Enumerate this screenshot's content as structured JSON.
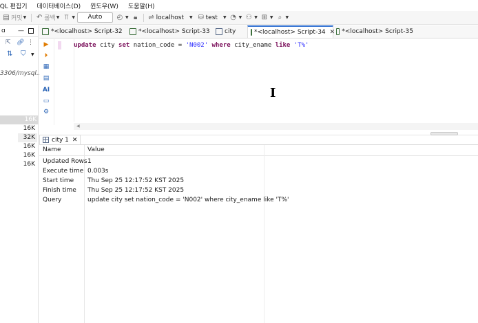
{
  "menu": {
    "items": [
      "SQL 편집기",
      "데이터베이스(D)",
      "윈도우(W)",
      "도움말(H)"
    ]
  },
  "toolbar": {
    "commit_label": "커밋",
    "rollback_label": "롤백",
    "transaction_mode": "Auto",
    "connection": "localhost",
    "database": "test"
  },
  "navigator": {
    "path_text": "3306/mysql...",
    "sizes": [
      "16K",
      "16K",
      "32K",
      "16K",
      "16K",
      "16K"
    ]
  },
  "editor_tabs": [
    {
      "label": "*<localhost> Script-32"
    },
    {
      "label": "*<localhost> Script-33"
    },
    {
      "label": "city"
    },
    {
      "label": "*<localhost> Script-34"
    },
    {
      "label": "*<localhost> Script-35"
    }
  ],
  "editor": {
    "sql": {
      "kw1": "update",
      "t1": "city",
      "kw2": "set",
      "t2": "nation_code =",
      "s1": "'N002'",
      "kw3": "where",
      "t3": "city_ename",
      "kw4": "like",
      "s2": "'T%'"
    },
    "gutter_ai_label": "AI"
  },
  "results": {
    "tab_label": "city 1",
    "header": {
      "name": "Name",
      "value": "Value"
    },
    "rows": [
      {
        "name": "Updated Rows",
        "value": "1"
      },
      {
        "name": "Execute time",
        "value": "0.003s"
      },
      {
        "name": "Start time",
        "value": "Thu Sep 25 12:17:52 KST 2025"
      },
      {
        "name": "Finish time",
        "value": "Thu Sep 25 12:17:52 KST 2025"
      },
      {
        "name": "Query",
        "value": "update city set nation_code = 'N002' where city_ename like 'T%'"
      }
    ]
  },
  "colors": {
    "keyword": "#7a0f5a",
    "string": "#2a2aff",
    "active_tab_accent": "#2f6fd0"
  }
}
